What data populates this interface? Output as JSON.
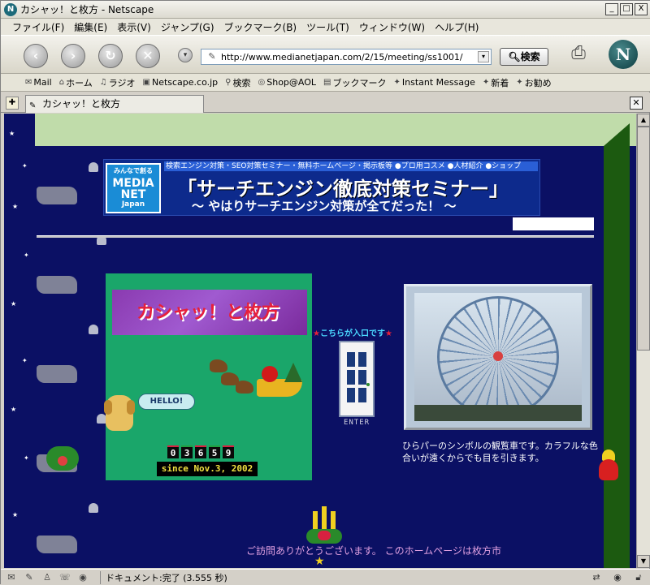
{
  "window": {
    "title": "カシャッ！と枚方 - Netscape",
    "minimize": "_",
    "maximize": "□",
    "close": "X"
  },
  "menu": [
    "ファイル(F)",
    "編集(E)",
    "表示(V)",
    "ジャンプ(G)",
    "ブックマーク(B)",
    "ツール(T)",
    "ウィンドウ(W)",
    "ヘルプ(H)"
  ],
  "nav": {
    "url": "http://www.medianetjapan.com/2/15/meeting/ss1001/",
    "search_label": "検索",
    "logo": "N"
  },
  "personal_toolbar": [
    "Mail",
    "ホーム",
    "ラジオ",
    "Netscape.co.jp",
    "検索",
    "Shop@AOL",
    "ブックマーク",
    "Instant Message",
    "新着",
    "お勧め"
  ],
  "tab": {
    "label": "カシャッ！と枚方"
  },
  "page": {
    "banner": {
      "logo_l1": "みんなで創る",
      "logo_l2": "MEDIA NET",
      "logo_l3": "Japan",
      "topline": "検索エンジン対策・SEO対策セミナー・無料ホームページ・掲示板等 ●プロ用コスメ ●人材紹介 ●ショップ",
      "headline": "「サーチエンジン徹底対策セミナー」",
      "subline": "〜 やはりサーチエンジン対策が全てだった！ 〜"
    },
    "site_title": "カシャッ！と枚方",
    "bubble": "HELLO!",
    "counter_digits": [
      "0",
      "3",
      "6",
      "5",
      "9"
    ],
    "since": "since Nov.3, 2002",
    "entrance_label": "こちらが入口です",
    "enter": "ENTER",
    "caption": "ひらパーのシンボルの観覧車です。カラフルな色合いが遠くからでも目を引きます。",
    "thanks": "ご訪問ありがとうございます。 このホームページは枚方市"
  },
  "status": {
    "text": "ドキュメント:完了 (3.555 秒)"
  }
}
